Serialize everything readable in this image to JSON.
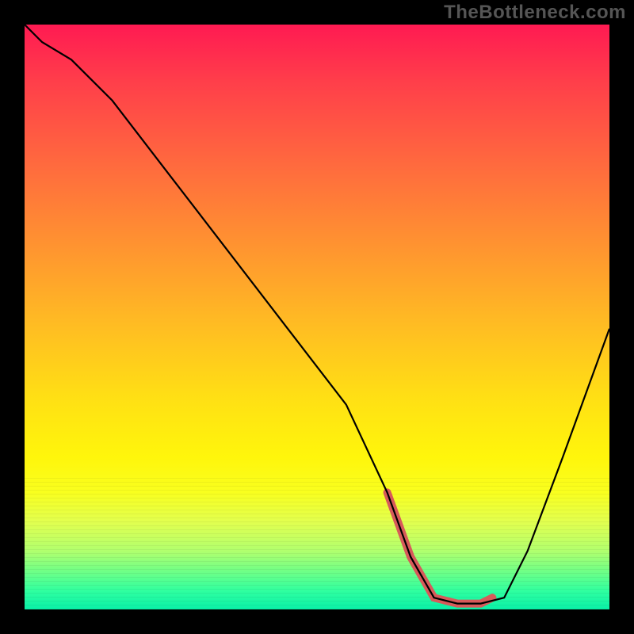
{
  "watermark": "TheBottleneck.com",
  "chart_data": {
    "type": "line",
    "title": "",
    "xlabel": "",
    "ylabel": "",
    "xlim": [
      0,
      100
    ],
    "ylim": [
      0,
      100
    ],
    "grid": false,
    "series": [
      {
        "name": "curve",
        "x": [
          0,
          3,
          8,
          15,
          25,
          35,
          45,
          55,
          62,
          66,
          70,
          74,
          78,
          82,
          86,
          92,
          100
        ],
        "values": [
          100,
          97,
          94,
          87,
          74,
          61,
          48,
          35,
          20,
          9,
          2,
          1,
          1,
          2,
          10,
          26,
          48
        ]
      }
    ],
    "highlight": {
      "name": "red-segment",
      "color": "#d75a5a",
      "x": [
        62,
        66,
        70,
        74,
        78,
        80
      ],
      "values": [
        20,
        9,
        2,
        1,
        1,
        2
      ]
    },
    "background_gradient": {
      "top": "#ff1a52",
      "bottom": "#0af0a8",
      "stops": [
        "red-pink",
        "orange",
        "yellow",
        "green"
      ]
    }
  }
}
